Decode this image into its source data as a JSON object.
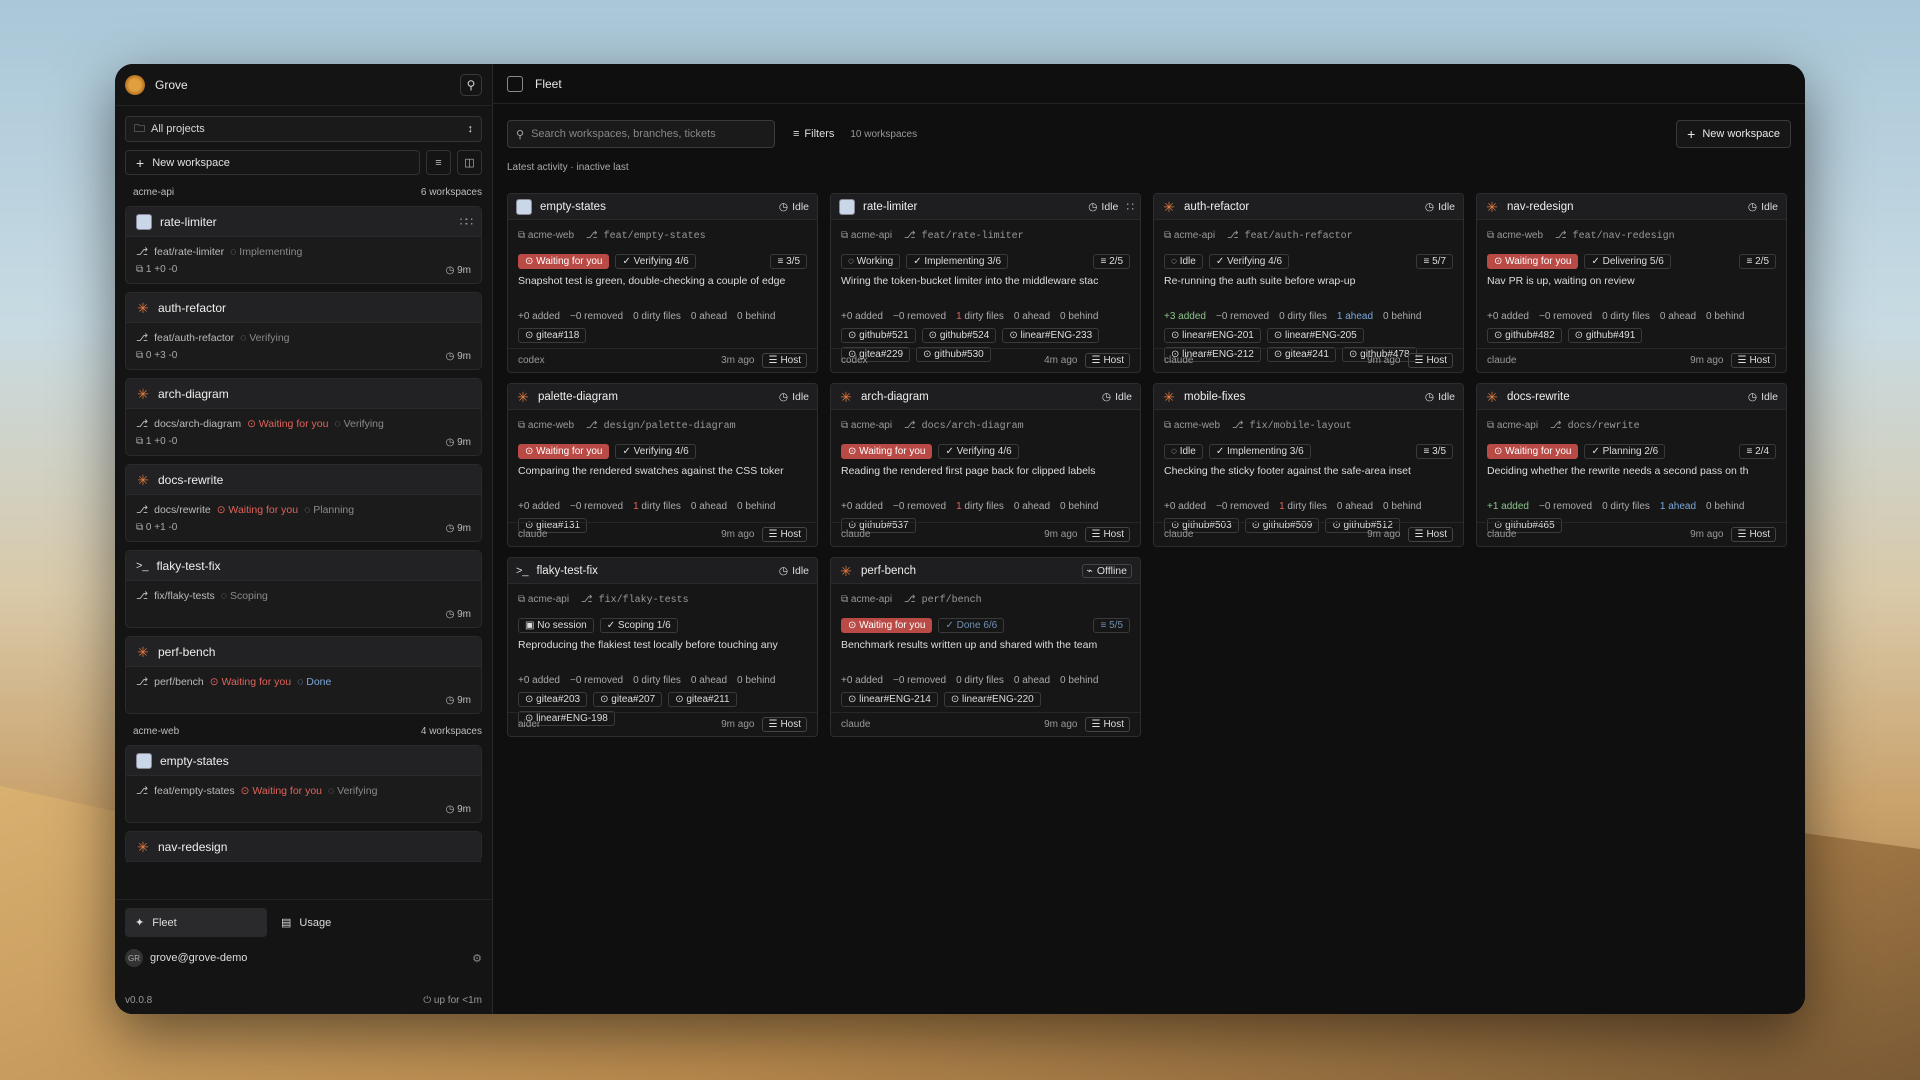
{
  "app": {
    "title": "Grove",
    "version": "v0.0.8",
    "uptime": "up for <1m"
  },
  "sidebar": {
    "project_select": "All projects",
    "new_workspace": "New workspace",
    "groups": [
      {
        "name": "acme-api",
        "count": "6 workspaces",
        "items": [
          {
            "name": "rate-limiter",
            "icon": "avatar",
            "branch": "feat/rate-limiter",
            "statuses": [
              {
                "t": "Implementing",
                "c": "mut"
              }
            ],
            "diff": "1 +0 -0",
            "time": "9m",
            "spinner": true
          },
          {
            "name": "auth-refactor",
            "icon": "burst",
            "branch": "feat/auth-refactor",
            "statuses": [
              {
                "t": "Verifying",
                "c": "mut"
              }
            ],
            "diff": "0 +3 -0",
            "time": "9m"
          },
          {
            "name": "arch-diagram",
            "icon": "burst",
            "branch": "docs/arch-diagram",
            "statuses": [
              {
                "t": "Waiting for you",
                "c": "red"
              },
              {
                "t": "Verifying",
                "c": "mut"
              }
            ],
            "diff": "1 +0 -0",
            "time": "9m"
          },
          {
            "name": "docs-rewrite",
            "icon": "burst",
            "branch": "docs/rewrite",
            "statuses": [
              {
                "t": "Waiting for you",
                "c": "red"
              },
              {
                "t": "Planning",
                "c": "mut"
              }
            ],
            "diff": "0 +1 -0",
            "time": "9m"
          },
          {
            "name": "flaky-test-fix",
            "icon": "prompt",
            "branch": "fix/flaky-tests",
            "statuses": [
              {
                "t": "Scoping",
                "c": "mut"
              }
            ],
            "diff": "",
            "time": "9m"
          },
          {
            "name": "perf-bench",
            "icon": "burst",
            "branch": "perf/bench",
            "statuses": [
              {
                "t": "Waiting for you",
                "c": "red"
              },
              {
                "t": "Done",
                "c": "blu"
              }
            ],
            "diff": "",
            "time": "9m"
          }
        ]
      },
      {
        "name": "acme-web",
        "count": "4 workspaces",
        "items": [
          {
            "name": "empty-states",
            "icon": "avatar",
            "branch": "feat/empty-states",
            "statuses": [
              {
                "t": "Waiting for you",
                "c": "red"
              },
              {
                "t": "Verifying",
                "c": "mut"
              }
            ],
            "diff": "",
            "time": "9m"
          },
          {
            "name": "nav-redesign",
            "icon": "burst",
            "branch": "",
            "statuses": [],
            "diff": "",
            "time": ""
          }
        ]
      }
    ],
    "tabs": [
      "Fleet",
      "Usage"
    ],
    "user": "grove@grove-demo",
    "user_initials": "GR"
  },
  "main": {
    "title": "Fleet",
    "search_placeholder": "Search workspaces, branches, tickets",
    "filters": "Filters",
    "count": "10 workspaces",
    "new_workspace": "New workspace",
    "sort": "Latest activity · inactive last",
    "cards": [
      {
        "name": "empty-states",
        "icon": "avatar",
        "state": "Idle",
        "repo": "acme-web",
        "branch": "feat/empty-states",
        "wait": true,
        "phase": "Verifying 4/6",
        "ratio": "3/5",
        "desc": "Snapshot test is green, double-checking a couple of edge",
        "stats": [
          "+0 added",
          "−0 removed",
          "0 dirty files",
          "0 ahead",
          "0 behind"
        ],
        "refs": [
          "gitea#118"
        ],
        "agent": "codex",
        "ago": "3m ago"
      },
      {
        "name": "rate-limiter",
        "icon": "avatar",
        "state": "Idle",
        "repo": "acme-api",
        "branch": "feat/rate-limiter",
        "wait": false,
        "working": "Working",
        "phase": "Implementing 3/6",
        "ratio": "2/5",
        "desc": "Wiring the token-bucket limiter into the middleware stac",
        "stats": [
          "+0 added",
          "−0 removed",
          "1 dirty files",
          "0 ahead",
          "0 behind"
        ],
        "refs": [
          "github#521",
          "github#524",
          "linear#ENG-233",
          "gitea#229",
          "github#530"
        ],
        "agent": "codex",
        "ago": "4m ago"
      },
      {
        "name": "auth-refactor",
        "icon": "burst",
        "state": "Idle",
        "repo": "acme-api",
        "branch": "feat/auth-refactor",
        "wait": false,
        "working": "Idle",
        "phase": "Verifying 4/6",
        "ratio": "5/7",
        "desc": "Re-running the auth suite before wrap-up",
        "stats": [
          "+3 added",
          "−0 removed",
          "0 dirty files",
          "1 ahead",
          "0 behind"
        ],
        "refs": [
          "linear#ENG-201",
          "linear#ENG-205",
          "linear#ENG-212",
          "gitea#241",
          "github#478"
        ],
        "agent": "claude",
        "ago": "9m ago"
      },
      {
        "name": "nav-redesign",
        "icon": "burst",
        "state": "Idle",
        "repo": "acme-web",
        "branch": "feat/nav-redesign",
        "wait": true,
        "phase": "Delivering 5/6",
        "ratio": "2/5",
        "desc": "Nav PR is up, waiting on review",
        "stats": [
          "+0 added",
          "−0 removed",
          "0 dirty files",
          "0 ahead",
          "0 behind"
        ],
        "refs": [
          "github#482",
          "github#491"
        ],
        "agent": "claude",
        "ago": "9m ago"
      },
      {
        "name": "palette-diagram",
        "icon": "burst",
        "state": "Idle",
        "repo": "acme-web",
        "branch": "design/palette-diagram",
        "wait": true,
        "phase": "Verifying 4/6",
        "ratio": "",
        "desc": "Comparing the rendered swatches against the CSS toker",
        "stats": [
          "+0 added",
          "−0 removed",
          "1 dirty files",
          "0 ahead",
          "0 behind"
        ],
        "refs": [
          "gitea#131"
        ],
        "agent": "claude",
        "ago": "9m ago"
      },
      {
        "name": "arch-diagram",
        "icon": "burst",
        "state": "Idle",
        "repo": "acme-api",
        "branch": "docs/arch-diagram",
        "wait": true,
        "phase": "Verifying 4/6",
        "ratio": "",
        "desc": "Reading the rendered first page back for clipped labels",
        "stats": [
          "+0 added",
          "−0 removed",
          "1 dirty files",
          "0 ahead",
          "0 behind"
        ],
        "refs": [
          "github#537"
        ],
        "agent": "claude",
        "ago": "9m ago"
      },
      {
        "name": "mobile-fixes",
        "icon": "burst",
        "state": "Idle",
        "repo": "acme-web",
        "branch": "fix/mobile-layout",
        "wait": false,
        "working": "Idle",
        "phase": "Implementing 3/6",
        "ratio": "3/5",
        "desc": "Checking the sticky footer against the safe-area inset",
        "stats": [
          "+0 added",
          "−0 removed",
          "1 dirty files",
          "0 ahead",
          "0 behind"
        ],
        "refs": [
          "github#503",
          "github#509",
          "github#512"
        ],
        "agent": "claude",
        "ago": "9m ago"
      },
      {
        "name": "docs-rewrite",
        "icon": "burst",
        "state": "Idle",
        "repo": "acme-api",
        "branch": "docs/rewrite",
        "wait": true,
        "phase": "Planning 2/6",
        "ratio": "2/4",
        "desc": "Deciding whether the rewrite needs a second pass on th",
        "stats": [
          "+1 added",
          "−0 removed",
          "0 dirty files",
          "1 ahead",
          "0 behind"
        ],
        "refs": [
          "github#465"
        ],
        "agent": "claude",
        "ago": "9m ago"
      },
      {
        "name": "flaky-test-fix",
        "icon": "prompt",
        "state": "Idle",
        "repo": "acme-api",
        "branch": "fix/flaky-tests",
        "wait": false,
        "working": "No session",
        "phase": "Scoping 1/6",
        "ratio": "",
        "desc": "Reproducing the flakiest test locally before touching any",
        "stats": [
          "+0 added",
          "−0 removed",
          "0 dirty files",
          "0 ahead",
          "0 behind"
        ],
        "refs": [
          "gitea#203",
          "gitea#207",
          "gitea#211",
          "linear#ENG-198"
        ],
        "agent": "aider",
        "ago": "9m ago"
      },
      {
        "name": "perf-bench",
        "icon": "burst",
        "state": "Offline",
        "repo": "acme-api",
        "branch": "perf/bench",
        "wait": true,
        "phase": "Done 6/6",
        "ratio": "5/5",
        "desc": "Benchmark results written up and shared with the team",
        "stats": [
          "+0 added",
          "−0 removed",
          "0 dirty files",
          "0 ahead",
          "0 behind"
        ],
        "refs": [
          "linear#ENG-214",
          "linear#ENG-220"
        ],
        "agent": "claude",
        "ago": "9m ago"
      }
    ],
    "labels": {
      "waiting": "Waiting for you",
      "host": "Host"
    }
  }
}
